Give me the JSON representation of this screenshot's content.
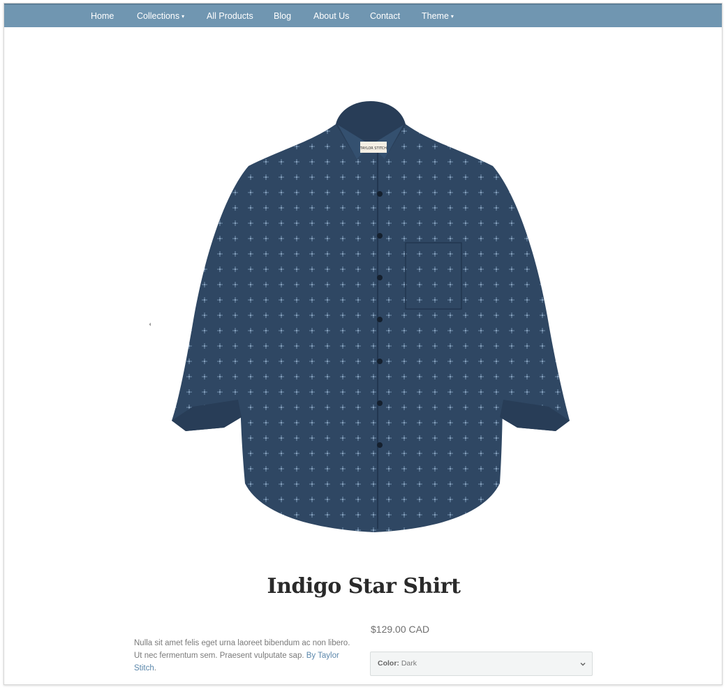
{
  "nav": {
    "items": [
      {
        "label": "Home"
      },
      {
        "label": "Collections"
      },
      {
        "label": "All Products"
      },
      {
        "label": "Blog"
      },
      {
        "label": "About Us"
      },
      {
        "label": "Contact"
      },
      {
        "label": "Theme"
      }
    ],
    "caret": "⌄"
  },
  "gallery": {
    "prev_icon": "chevron-left-icon",
    "next_icon": "chevron-right-icon",
    "label_text": "TAYLOR STITCH"
  },
  "product": {
    "title": "Indigo Star Shirt",
    "price": "$129.00 CAD",
    "description": "Nulla sit amet felis eget urna laoreet bibendum ac non libero. Ut nec fermentum sem. Praesent vulputate sap. ",
    "vendor_link": "By Taylor Stitch",
    "description_end": ".",
    "option_label": "Color:",
    "option_value": "Dark"
  },
  "colors": {
    "nav_bg": "#7096b1",
    "link": "#5b87ab",
    "shirt": "#2f4763"
  }
}
